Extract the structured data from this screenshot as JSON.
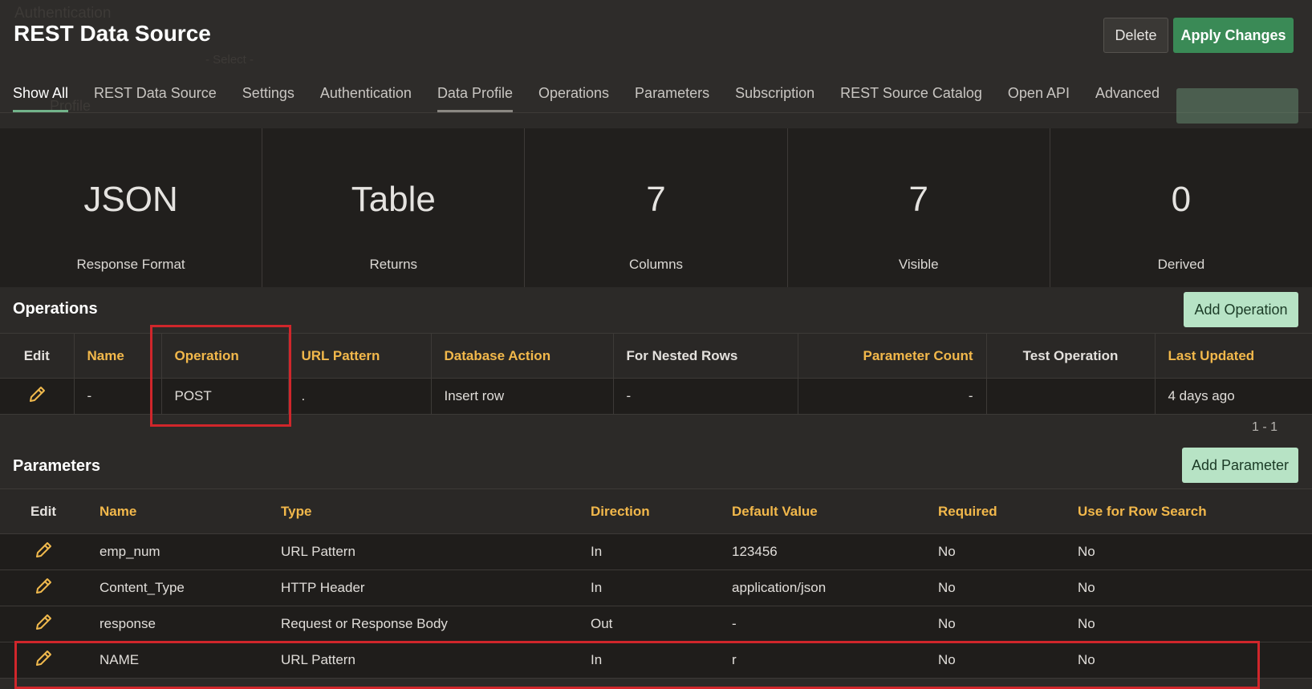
{
  "header": {
    "ghost_auth": "Authentication",
    "ghost_select": "- Select -",
    "ghost_profile": "Profile",
    "title": "REST Data Source",
    "delete_label": "Delete",
    "apply_label": "Apply Changes"
  },
  "tabs": [
    {
      "label": "Show All"
    },
    {
      "label": "REST Data Source"
    },
    {
      "label": "Settings"
    },
    {
      "label": "Authentication"
    },
    {
      "label": "Data Profile"
    },
    {
      "label": "Operations"
    },
    {
      "label": "Parameters"
    },
    {
      "label": "Subscription"
    },
    {
      "label": "REST Source Catalog"
    },
    {
      "label": "Open API"
    },
    {
      "label": "Advanced"
    }
  ],
  "stats": [
    {
      "value": "JSON",
      "label": "Response Format"
    },
    {
      "value": "Table",
      "label": "Returns"
    },
    {
      "value": "7",
      "label": "Columns"
    },
    {
      "value": "7",
      "label": "Visible"
    },
    {
      "value": "0",
      "label": "Derived"
    }
  ],
  "operations": {
    "title": "Operations",
    "add_label": "Add Operation",
    "columns": [
      "Edit",
      "Name",
      "Operation",
      "URL Pattern",
      "Database Action",
      "For Nested Rows",
      "Parameter Count",
      "Test Operation",
      "Last Updated"
    ],
    "rows": [
      {
        "name": "-",
        "operation": "POST",
        "url_pattern": ".",
        "database_action": "Insert row",
        "for_nested_rows": "-",
        "parameter_count": "-",
        "test_operation": "",
        "last_updated": "4 days ago"
      }
    ],
    "pagination": "1 - 1"
  },
  "parameters": {
    "title": "Parameters",
    "add_label": "Add Parameter",
    "columns": [
      "Edit",
      "Name",
      "Type",
      "Direction",
      "Default Value",
      "Required",
      "Use for Row Search"
    ],
    "rows": [
      {
        "name": "emp_num",
        "type": "URL Pattern",
        "direction": "In",
        "default_value": "123456",
        "required": "No",
        "row_search": "No"
      },
      {
        "name": "Content_Type",
        "type": "HTTP Header",
        "direction": "In",
        "default_value": "application/json",
        "required": "No",
        "row_search": "No"
      },
      {
        "name": "response",
        "type": "Request or Response Body",
        "direction": "Out",
        "default_value": "-",
        "required": "No",
        "row_search": "No"
      },
      {
        "name": "NAME",
        "type": "URL Pattern",
        "direction": "In",
        "default_value": "r",
        "required": "No",
        "row_search": "No"
      }
    ]
  },
  "colors": {
    "accent_green": "#3a8a56",
    "header_gold": "#f2b84b",
    "highlight_red": "#d0262b",
    "add_button": "#b7e3c5"
  },
  "icons": {
    "edit": "pencil-icon"
  }
}
